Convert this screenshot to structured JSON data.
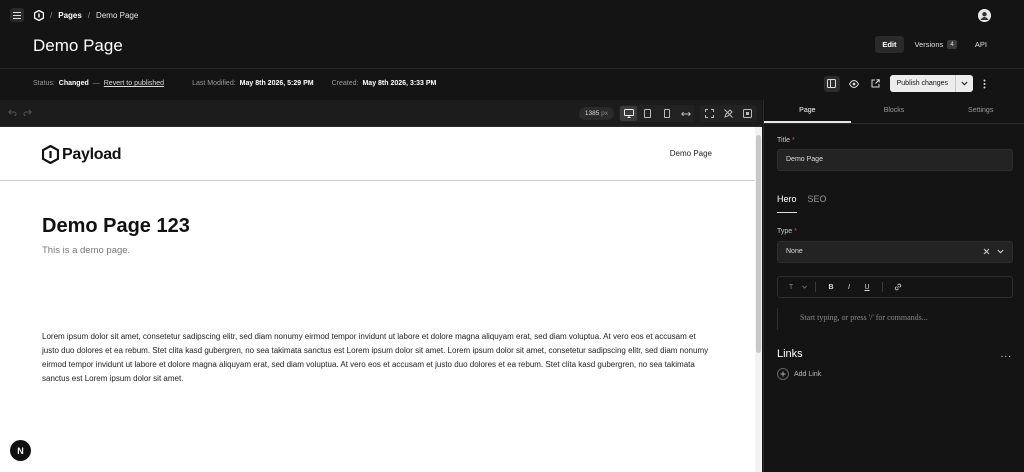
{
  "breadcrumb": {
    "sep": "/",
    "items": [
      "Pages",
      "Demo Page"
    ]
  },
  "document": {
    "title": "Demo Page"
  },
  "header_tabs": [
    {
      "label": "Edit"
    },
    {
      "label": "Versions",
      "count": "4"
    },
    {
      "label": "API"
    }
  ],
  "status": {
    "status_label": "Status:",
    "status_value": "Changed",
    "dash": "—",
    "revert_link": "Revert to published",
    "modified_label": "Last Modified:",
    "modified_value": "May 8th 2026, 5:29 PM",
    "created_label": "Created:",
    "created_value": "May 8th 2026, 3:33 PM"
  },
  "actions": {
    "publish_label": "Publish changes"
  },
  "preview_toolbar": {
    "width_value": "1385",
    "width_unit": "px"
  },
  "preview": {
    "logo_text": "Payload",
    "nav_item": "Demo Page",
    "hero_title": "Demo Page 123",
    "hero_subtitle": "This is a demo page.",
    "body_text": "Lorem ipsum dolor sit amet, consetetur sadipscing elitr, sed diam nonumy eirmod tempor invidunt ut labore et dolore magna aliquyam erat, sed diam voluptua. At vero eos et accusam et justo duo dolores et ea rebum. Stet clita kasd gubergren, no sea takimata sanctus est Lorem ipsum dolor sit amet. Lorem ipsum dolor sit amet, consetetur sadipscing elitr, sed diam nonumy eirmod tempor invidunt ut labore et dolore magna aliquyam erat, sed diam voluptua. At vero eos et accusam et justo duo dolores et ea rebum. Stet clita kasd gubergren, no sea takimata sanctus est Lorem ipsum dolor sit amet.",
    "badge": "N"
  },
  "panel": {
    "tabs": [
      "Page",
      "Blocks",
      "Settings"
    ],
    "title_label": "Title",
    "required_mark": "*",
    "title_value": "Demo Page",
    "subtabs": [
      "Hero",
      "SEO"
    ],
    "type_label": "Type",
    "type_value": "None",
    "editor_placeholder": "Start typing, or press '/' for commands...",
    "links_title": "Links",
    "links_more": "...",
    "add_link": "Add Link",
    "rt_buttons": {
      "text": "T",
      "bold": "B",
      "italic": "I",
      "underline": "U"
    }
  },
  "colors": {
    "background": "#141414",
    "accent": "#ececec",
    "preview_bg": "#ffffff",
    "required": "#d94f4f"
  }
}
